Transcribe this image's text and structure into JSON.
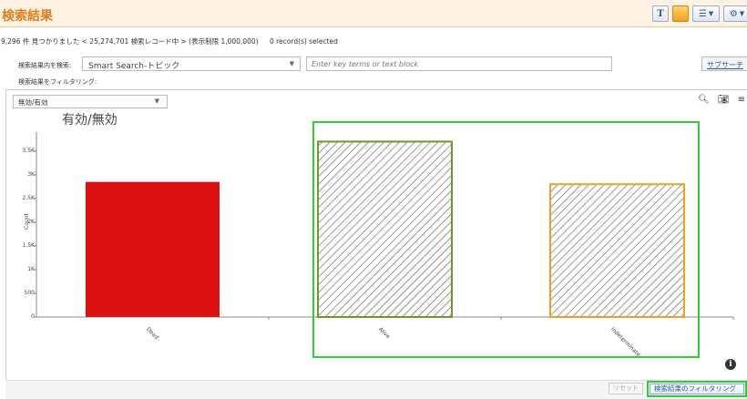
{
  "window": {
    "title": "検索結果"
  },
  "toolbar": {
    "icons": [
      "text-icon",
      "image-icon",
      "list-dropdown-icon",
      "gear-dropdown-icon"
    ],
    "t_label": "T"
  },
  "summary": {
    "text": "9,296 件  見つかりました < 25,274,701 検索レコード中 > (表示制限 1,000,000)",
    "selected": "0 record(s) selected"
  },
  "search": {
    "in_label": "検索結果内を検索:",
    "mode_value": "Smart Search-トピック",
    "placeholder": "Enter key terms or text block",
    "subsearch_label": "サブサーチ"
  },
  "filter": {
    "label": "検索結果をフィルタリング:",
    "field_value": "無効/有効"
  },
  "chart_data": {
    "type": "bar",
    "title": "有効/無効",
    "ylabel": "Count",
    "xlabel": "",
    "categories": [
      "Dead",
      "Alive",
      "Indeterminate"
    ],
    "values": [
      2850,
      3700,
      2800
    ],
    "ylim": [
      0,
      3900
    ],
    "yticks": [
      "0",
      "500",
      "1K",
      "1.5K",
      "2K",
      "2.5K",
      "3K",
      "3.5K"
    ],
    "bar_styles": [
      {
        "fill": "#dd1111",
        "stroke": "#dd1111",
        "hatch": false
      },
      {
        "fill": "#ffffff",
        "stroke": "#6a9a2a",
        "hatch": true
      },
      {
        "fill": "#ffffff",
        "stroke": "#f0a020",
        "hatch": true
      }
    ]
  },
  "buttons": {
    "reset": "リセット",
    "apply_filter": "検索結果のフィルタリング"
  },
  "colors": {
    "accent": "#e0801a",
    "highlight": "#33cc33",
    "link": "#2a5aa0"
  }
}
